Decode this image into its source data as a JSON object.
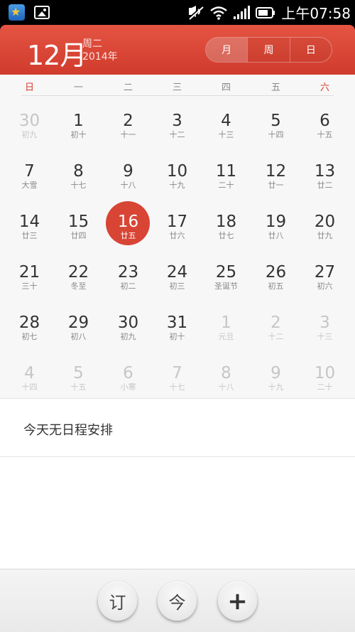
{
  "status_bar": {
    "time": "上午07:58",
    "icons": [
      "qq-star-icon",
      "gallery-icon",
      "mute-icon",
      "wifi-icon",
      "signal-icon",
      "battery-icon"
    ]
  },
  "header": {
    "month": "12月",
    "weekday": "周二",
    "year": "2014年",
    "view_tabs": [
      "月",
      "周",
      "日"
    ],
    "active_view": "月",
    "accent_color": "#d84535"
  },
  "weekdays": [
    "日",
    "一",
    "二",
    "三",
    "四",
    "五",
    "六"
  ],
  "weeks": [
    [
      {
        "d": "30",
        "l": "初九",
        "dim": true
      },
      {
        "d": "1",
        "l": "初十"
      },
      {
        "d": "2",
        "l": "十一"
      },
      {
        "d": "3",
        "l": "十二"
      },
      {
        "d": "4",
        "l": "十三"
      },
      {
        "d": "5",
        "l": "十四"
      },
      {
        "d": "6",
        "l": "十五"
      }
    ],
    [
      {
        "d": "7",
        "l": "大雪"
      },
      {
        "d": "8",
        "l": "十七"
      },
      {
        "d": "9",
        "l": "十八"
      },
      {
        "d": "10",
        "l": "十九"
      },
      {
        "d": "11",
        "l": "二十"
      },
      {
        "d": "12",
        "l": "廿一"
      },
      {
        "d": "13",
        "l": "廿二"
      }
    ],
    [
      {
        "d": "14",
        "l": "廿三"
      },
      {
        "d": "15",
        "l": "廿四"
      },
      {
        "d": "16",
        "l": "廿五",
        "today": true
      },
      {
        "d": "17",
        "l": "廿六"
      },
      {
        "d": "18",
        "l": "廿七"
      },
      {
        "d": "19",
        "l": "廿八"
      },
      {
        "d": "20",
        "l": "廿九"
      }
    ],
    [
      {
        "d": "21",
        "l": "三十"
      },
      {
        "d": "22",
        "l": "冬至"
      },
      {
        "d": "23",
        "l": "初二"
      },
      {
        "d": "24",
        "l": "初三"
      },
      {
        "d": "25",
        "l": "圣诞节"
      },
      {
        "d": "26",
        "l": "初五"
      },
      {
        "d": "27",
        "l": "初六"
      }
    ],
    [
      {
        "d": "28",
        "l": "初七"
      },
      {
        "d": "29",
        "l": "初八"
      },
      {
        "d": "30",
        "l": "初九"
      },
      {
        "d": "31",
        "l": "初十"
      },
      {
        "d": "1",
        "l": "元旦",
        "dim": true
      },
      {
        "d": "2",
        "l": "十二",
        "dim": true
      },
      {
        "d": "3",
        "l": "十三",
        "dim": true
      }
    ],
    [
      {
        "d": "4",
        "l": "十四",
        "dim": true
      },
      {
        "d": "5",
        "l": "十五",
        "dim": true
      },
      {
        "d": "6",
        "l": "小寒",
        "dim": true
      },
      {
        "d": "7",
        "l": "十七",
        "dim": true
      },
      {
        "d": "8",
        "l": "十八",
        "dim": true
      },
      {
        "d": "9",
        "l": "十九",
        "dim": true
      },
      {
        "d": "10",
        "l": "二十",
        "dim": true
      }
    ]
  ],
  "agenda": {
    "empty_text": "今天无日程安排"
  },
  "bottom_bar": {
    "subscribe_label": "订",
    "today_label": "今",
    "add_label": "+"
  }
}
